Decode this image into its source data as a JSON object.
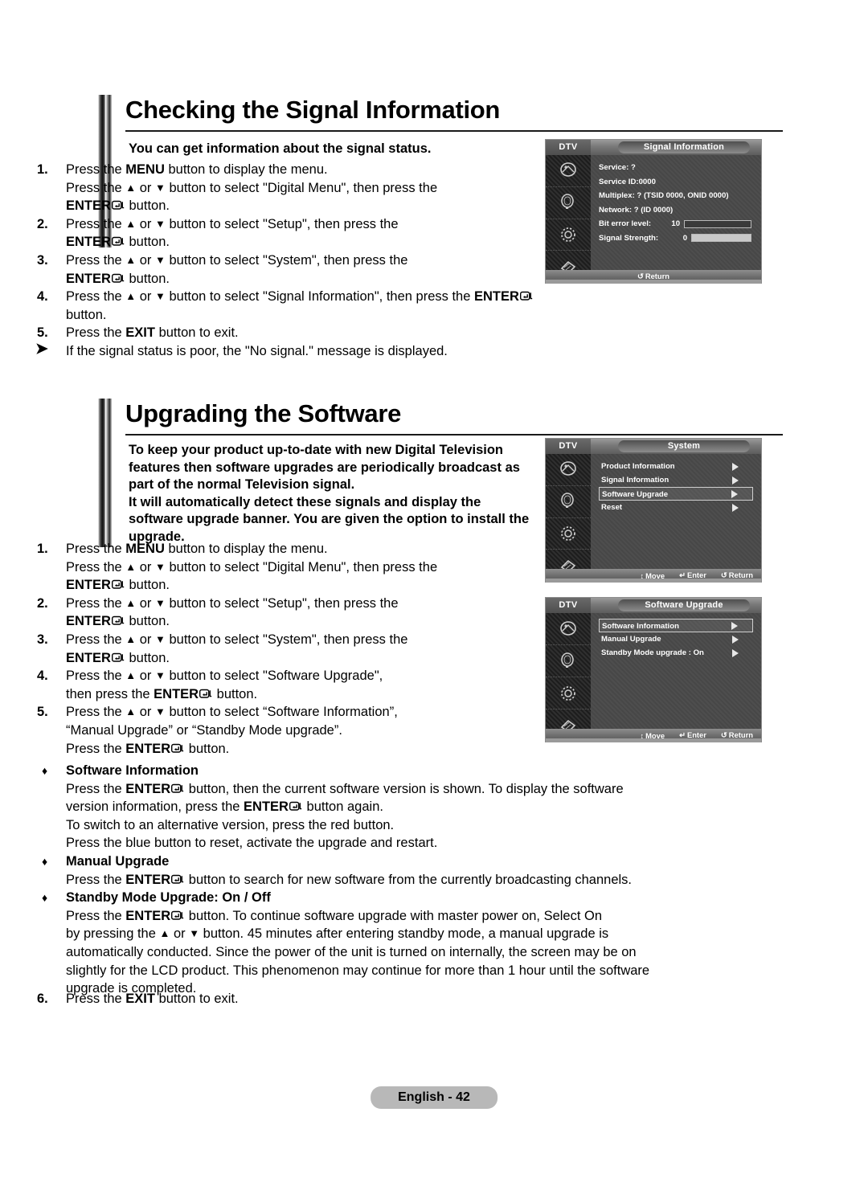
{
  "page": {
    "footer_label": "English - 42"
  },
  "section1": {
    "heading": "Checking the Signal Information",
    "intro": "You can get information about the signal status.",
    "steps": [
      {
        "num": "1.",
        "lines": [
          [
            {
              "t": "Press the ",
              "b": false
            },
            {
              "t": "MENU",
              "b": true
            },
            {
              "t": " button to display the menu.",
              "b": false
            }
          ],
          [
            {
              "t": "Press the ",
              "b": false
            },
            {
              "t": "▲",
              "b": true
            },
            {
              "t": " or ",
              "b": false
            },
            {
              "t": "▼",
              "b": true
            },
            {
              "t": " button to select \"Digital Menu\", then press the",
              "b": false
            }
          ],
          [
            {
              "t": "ENTER",
              "b": true
            },
            {
              "t": "@ENTER@",
              "b": false
            },
            {
              "t": " button.",
              "b": false
            }
          ]
        ]
      },
      {
        "num": "2.",
        "lines": [
          [
            {
              "t": "Press the ",
              "b": false
            },
            {
              "t": "▲",
              "b": true
            },
            {
              "t": " or ",
              "b": false
            },
            {
              "t": "▼",
              "b": true
            },
            {
              "t": " button to select \"Setup\", then press the",
              "b": false
            }
          ],
          [
            {
              "t": "ENTER",
              "b": true
            },
            {
              "t": "@ENTER@",
              "b": false
            },
            {
              "t": " button.",
              "b": false
            }
          ]
        ]
      },
      {
        "num": "3.",
        "lines": [
          [
            {
              "t": "Press the ",
              "b": false
            },
            {
              "t": "▲",
              "b": true
            },
            {
              "t": " or ",
              "b": false
            },
            {
              "t": "▼",
              "b": true
            },
            {
              "t": " button to select \"System\", then press the",
              "b": false
            }
          ],
          [
            {
              "t": "ENTER",
              "b": true
            },
            {
              "t": "@ENTER@",
              "b": false
            },
            {
              "t": " button.",
              "b": false
            }
          ]
        ]
      },
      {
        "num": "4.",
        "lines": [
          [
            {
              "t": "Press the ",
              "b": false
            },
            {
              "t": "▲",
              "b": true
            },
            {
              "t": " or ",
              "b": false
            },
            {
              "t": "▼",
              "b": true
            },
            {
              "t": " button to select \"Signal Information\", then press the ",
              "b": false
            },
            {
              "t": "ENTER",
              "b": true
            },
            {
              "t": "@ENTER@",
              "b": false
            },
            {
              "t": " button.",
              "b": false
            }
          ]
        ]
      },
      {
        "num": "5.",
        "lines": [
          [
            {
              "t": "Press the ",
              "b": false
            },
            {
              "t": "EXIT",
              "b": true
            },
            {
              "t": " button to exit.",
              "b": false
            }
          ]
        ]
      },
      {
        "num": "➤",
        "note": true,
        "lines": [
          [
            {
              "t": "If the signal status is poor, the \"No signal.\" message is displayed.",
              "b": false
            }
          ]
        ]
      }
    ]
  },
  "section2": {
    "heading": "Upgrading the Software",
    "intro_lines": [
      "To keep your product up-to-date with new Digital Television",
      "features then software upgrades are periodically broadcast as",
      "part of the normal Television signal.",
      "It will automatically detect these signals and display the",
      "software upgrade banner. You are given the option to install the",
      "upgrade."
    ],
    "steps": [
      {
        "num": "1.",
        "lines": [
          [
            {
              "t": "Press the ",
              "b": false
            },
            {
              "t": "MENU",
              "b": true
            },
            {
              "t": " button to display the menu.",
              "b": false
            }
          ],
          [
            {
              "t": "Press the ",
              "b": false
            },
            {
              "t": "▲",
              "b": true
            },
            {
              "t": " or ",
              "b": false
            },
            {
              "t": "▼",
              "b": true
            },
            {
              "t": " button to select \"Digital Menu\", then press the",
              "b": false
            }
          ],
          [
            {
              "t": "ENTER",
              "b": true
            },
            {
              "t": "@ENTER@",
              "b": false
            },
            {
              "t": " button.",
              "b": false
            }
          ]
        ]
      },
      {
        "num": "2.",
        "lines": [
          [
            {
              "t": "Press the ",
              "b": false
            },
            {
              "t": "▲",
              "b": true
            },
            {
              "t": " or ",
              "b": false
            },
            {
              "t": "▼",
              "b": true
            },
            {
              "t": " button to select \"Setup\", then press the",
              "b": false
            }
          ],
          [
            {
              "t": "ENTER",
              "b": true
            },
            {
              "t": "@ENTER@",
              "b": false
            },
            {
              "t": " button.",
              "b": false
            }
          ]
        ]
      },
      {
        "num": "3.",
        "lines": [
          [
            {
              "t": "Press the ",
              "b": false
            },
            {
              "t": "▲",
              "b": true
            },
            {
              "t": " or ",
              "b": false
            },
            {
              "t": "▼",
              "b": true
            },
            {
              "t": " button to select \"System\", then press the",
              "b": false
            }
          ],
          [
            {
              "t": "ENTER",
              "b": true
            },
            {
              "t": "@ENTER@",
              "b": false
            },
            {
              "t": " button.",
              "b": false
            }
          ]
        ]
      },
      {
        "num": "4.",
        "lines": [
          [
            {
              "t": "Press the ",
              "b": false
            },
            {
              "t": "▲",
              "b": true
            },
            {
              "t": " or ",
              "b": false
            },
            {
              "t": "▼",
              "b": true
            },
            {
              "t": " button to select \"Software Upgrade\",",
              "b": false
            }
          ],
          [
            {
              "t": "then press the ",
              "b": false
            },
            {
              "t": "ENTER",
              "b": true
            },
            {
              "t": "@ENTER@",
              "b": false
            },
            {
              "t": " button.",
              "b": false
            }
          ]
        ]
      },
      {
        "num": "5.",
        "lines": [
          [
            {
              "t": "Press the ",
              "b": false
            },
            {
              "t": "▲",
              "b": true
            },
            {
              "t": " or ",
              "b": false
            },
            {
              "t": "▼",
              "b": true
            },
            {
              "t": " button to select “Software Information”,",
              "b": false
            }
          ],
          [
            {
              "t": "“Manual Upgrade” or “Standby Mode upgrade”.",
              "b": false
            }
          ],
          [
            {
              "t": "Press the ",
              "b": false
            },
            {
              "t": "ENTER",
              "b": true
            },
            {
              "t": "@ENTER@",
              "b": false
            },
            {
              "t": " button.",
              "b": false
            }
          ]
        ]
      }
    ],
    "diamond_items": [
      {
        "title": "Software Information",
        "lines": [
          [
            {
              "t": "Press the ",
              "b": false
            },
            {
              "t": "ENTER",
              "b": true
            },
            {
              "t": "@ENTER@",
              "b": false
            },
            {
              "t": " button, then the current software version is shown. To display the software",
              "b": false
            }
          ],
          [
            {
              "t": "version information, press the ",
              "b": false
            },
            {
              "t": "ENTER",
              "b": true
            },
            {
              "t": "@ENTER@",
              "b": false
            },
            {
              "t": " button again.",
              "b": false
            }
          ],
          [
            {
              "t": "To switch to an alternative version, press the red button.",
              "b": false
            }
          ],
          [
            {
              "t": "Press the blue button to reset, activate the upgrade and restart.",
              "b": false
            }
          ]
        ]
      },
      {
        "title": "Manual Upgrade",
        "lines": [
          [
            {
              "t": "Press the ",
              "b": false
            },
            {
              "t": "ENTER",
              "b": true
            },
            {
              "t": "@ENTER@",
              "b": false
            },
            {
              "t": " button to search for new software from the currently broadcasting channels.",
              "b": false
            }
          ]
        ]
      },
      {
        "title": "Standby Mode Upgrade: On / Off",
        "lines": [
          [
            {
              "t": "Press the ",
              "b": false
            },
            {
              "t": "ENTER",
              "b": true
            },
            {
              "t": "@ENTER@",
              "b": false
            },
            {
              "t": " button. To continue software upgrade with master power on, Select On",
              "b": false
            }
          ],
          [
            {
              "t": "by pressing the ",
              "b": false
            },
            {
              "t": "▲",
              "b": true
            },
            {
              "t": " or ",
              "b": false
            },
            {
              "t": "▼",
              "b": true
            },
            {
              "t": " button. 45 minutes after entering standby mode, a manual upgrade is",
              "b": false
            }
          ],
          [
            {
              "t": "automatically conducted. Since the power of the unit is turned on internally, the screen may be on",
              "b": false
            }
          ],
          [
            {
              "t": "slightly for the LCD product. This phenomenon may continue for more than 1 hour until the software",
              "b": false
            }
          ],
          [
            {
              "t": "upgrade is completed.",
              "b": false
            }
          ]
        ]
      }
    ],
    "final_step": {
      "num": "6.",
      "lines": [
        [
          {
            "t": "Press the ",
            "b": false
          },
          {
            "t": "EXIT",
            "b": true
          },
          {
            "t": " button to exit.",
            "b": false
          }
        ]
      ]
    }
  },
  "osd_signal": {
    "dtv_label": "DTV",
    "title": "Signal Information",
    "rows": [
      {
        "label": "Service: ?",
        "type": "text"
      },
      {
        "label": "Service ID:0000",
        "type": "text"
      },
      {
        "label": "Multiplex: ? (TSID 0000, ONID 0000)",
        "type": "text"
      },
      {
        "label": "Network: ? (ID 0000)",
        "type": "text"
      },
      {
        "label": "Bit error level:",
        "value": "10",
        "type": "meter",
        "fill": "dark"
      },
      {
        "label": "Signal Strength:",
        "value": "0",
        "type": "meter",
        "fill": "light"
      }
    ],
    "bottom": [
      {
        "glyph": "↺",
        "text": "Return"
      }
    ]
  },
  "osd_system": {
    "dtv_label": "DTV",
    "title": "System",
    "items": [
      {
        "label": "Product Information",
        "selected": false
      },
      {
        "label": "Signal Information",
        "selected": false
      },
      {
        "label": "Software Upgrade",
        "selected": true
      },
      {
        "label": "Reset",
        "selected": false
      }
    ],
    "bottom": [
      {
        "glyph": "↕",
        "text": "Move"
      },
      {
        "glyph": "↵",
        "text": "Enter"
      },
      {
        "glyph": "↺",
        "text": "Return"
      }
    ]
  },
  "osd_software_upgrade": {
    "dtv_label": "DTV",
    "title": "Software Upgrade",
    "items": [
      {
        "label": "Software Information",
        "selected": true
      },
      {
        "label": "Manual Upgrade",
        "selected": false
      },
      {
        "label": "Standby Mode upgrade : On",
        "selected": false
      }
    ],
    "bottom": [
      {
        "glyph": "↕",
        "text": "Move"
      },
      {
        "glyph": "↵",
        "text": "Enter"
      },
      {
        "glyph": "↺",
        "text": "Return"
      }
    ]
  },
  "icons": {
    "col": [
      "picture-icon",
      "sound-icon",
      "setup-icon",
      "input-icon"
    ]
  }
}
